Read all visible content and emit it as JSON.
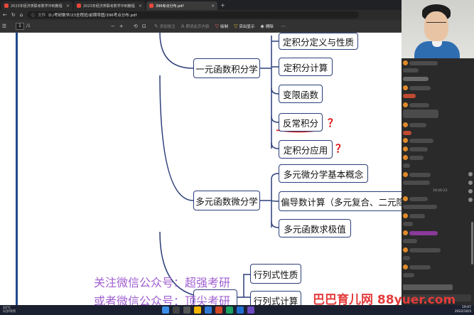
{
  "browser": {
    "tabs": [
      {
        "label": "2023年经济类联考数学冲刺教程",
        "active": false
      },
      {
        "label": "2023年经济类联考数学冲刺教程",
        "active": false
      },
      {
        "label": "396考点分布.pdf",
        "active": true
      }
    ],
    "address_label": "文件",
    "address_path": "D:/考研数学/23全程班/前期导图/396考点分布.pdf"
  },
  "pdf_toolbar": {
    "page_current": "1",
    "page_total": "/1",
    "buttons": [
      {
        "label": "添加批注",
        "icon": "comment-icon",
        "enabled": false
      },
      {
        "label": "朗读此页内容",
        "icon": "read-aloud-icon",
        "enabled": false
      },
      {
        "label": "绘制",
        "icon": "draw-icon",
        "enabled": true
      },
      {
        "label": "突出显示",
        "icon": "highlight-icon",
        "enabled": true
      },
      {
        "label": "擦除",
        "icon": "eraser-icon",
        "enabled": true
      }
    ]
  },
  "mindmap": {
    "branch1": "一元函数积分学",
    "branch1_items": [
      "定积分定义与性质",
      "定积分计算",
      "变限函数",
      "反常积分",
      "定积分应用"
    ],
    "branch2": "多元函数微分学",
    "branch2_items": [
      "多元微分学基本概念",
      "偏导数计算（多元复合、二元隐",
      "多元函数求极值"
    ],
    "branch3_items": [
      "行列式性质",
      "行列式计算"
    ],
    "question_mark": "？"
  },
  "watermarks": {
    "line1": "关注微信公众号：超强考研",
    "line2": "或者微信公众号：顶尖考研",
    "site": "巴巴育儿网 88yuer.com"
  },
  "chat": {
    "timestamp": "19:26:23"
  },
  "taskbar": {
    "temperature": "23°C",
    "weather_text": "局部晴朗",
    "time": "19:07",
    "date": "2022/10/3"
  },
  "colors": {
    "node_border": "#2c3e7a",
    "question_mark": "#dd1111",
    "watermark_purple": "#a15fd1",
    "watermark_red": "#e53b3b"
  }
}
